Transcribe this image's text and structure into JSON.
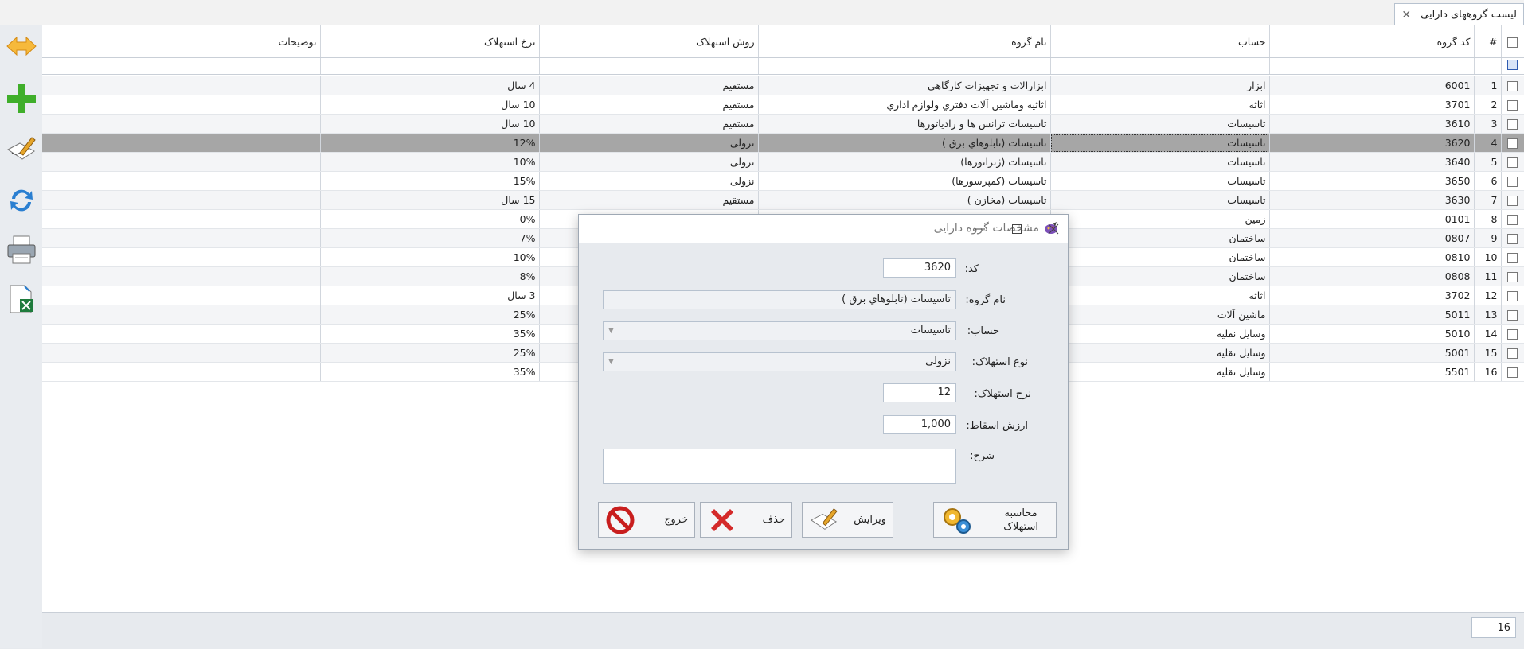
{
  "tab": {
    "title": "لیست گروههای دارایی",
    "close_glyph": "✕"
  },
  "toolbar": {
    "icons": [
      "expand-arrows-icon",
      "add-icon",
      "edit-icon",
      "refresh-icon",
      "print-icon",
      "excel-export-icon"
    ]
  },
  "grid": {
    "headers": {
      "row_number": "#",
      "code": "کد گروه",
      "account": "حساب",
      "group_name": "نام گروه",
      "method": "روش استهلاک",
      "rate": "نرخ استهلاک",
      "description": "توضیحات"
    },
    "rows": [
      {
        "n": "1",
        "code": "6001",
        "account": "ابزار",
        "name": "ابزارالات و تجهیزات کارگاهی",
        "method": "مستقیم",
        "rate": "4 سال",
        "desc": ""
      },
      {
        "n": "2",
        "code": "3701",
        "account": "اثاثه",
        "name": "اثاثیه وماشین آلات دفتري ولوازم اداري",
        "method": "مستقیم",
        "rate": "10 سال",
        "desc": ""
      },
      {
        "n": "3",
        "code": "3610",
        "account": "تاسیسات",
        "name": "تاسیسات ترانس ها و رادیاتورها",
        "method": "مستقیم",
        "rate": "10 سال",
        "desc": ""
      },
      {
        "n": "4",
        "code": "3620",
        "account": "تاسیسات",
        "name": "تاسیسات (تابلوهاي برق )",
        "method": "نزولی",
        "rate": "12%",
        "desc": ""
      },
      {
        "n": "5",
        "code": "3640",
        "account": "تاسیسات",
        "name": "تاسیسات (ژنراتورها)",
        "method": "نزولی",
        "rate": "10%",
        "desc": ""
      },
      {
        "n": "6",
        "code": "3650",
        "account": "تاسیسات",
        "name": "تاسیسات (کمپرسورها)",
        "method": "نزولی",
        "rate": "15%",
        "desc": ""
      },
      {
        "n": "7",
        "code": "3630",
        "account": "تاسیسات",
        "name": "تاسیسات (مخازن )",
        "method": "مستقیم",
        "rate": "15 سال",
        "desc": ""
      },
      {
        "n": "8",
        "code": "0101",
        "account": "زمین",
        "name": "",
        "method": "",
        "rate": "0%",
        "desc": ""
      },
      {
        "n": "9",
        "code": "0807",
        "account": "ساختمان",
        "name": "",
        "method": "",
        "rate": "7%",
        "desc": ""
      },
      {
        "n": "10",
        "code": "0810",
        "account": "ساختمان",
        "name": "",
        "method": "",
        "rate": "10%",
        "desc": ""
      },
      {
        "n": "11",
        "code": "0808",
        "account": "ساختمان",
        "name": "",
        "method": "",
        "rate": "8%",
        "desc": ""
      },
      {
        "n": "12",
        "code": "3702",
        "account": "اثاثه",
        "name": "",
        "method": "",
        "rate": "3 سال",
        "desc": ""
      },
      {
        "n": "13",
        "code": "5011",
        "account": "ماشین آلات",
        "name": "",
        "method": "",
        "rate": "25%",
        "desc": ""
      },
      {
        "n": "14",
        "code": "5010",
        "account": "وسایل نقلیه",
        "name": "",
        "method": "",
        "rate": "35%",
        "desc": ""
      },
      {
        "n": "15",
        "code": "5001",
        "account": "وسایل نقلیه",
        "name": "",
        "method": "",
        "rate": "25%",
        "desc": ""
      },
      {
        "n": "16",
        "code": "5501",
        "account": "وسایل نقلیه",
        "name": "",
        "method": "",
        "rate": "35%",
        "desc": ""
      }
    ],
    "selected_row": 4
  },
  "footer": {
    "record_count": "16"
  },
  "dialog": {
    "title": "مشخصات گروه دارایی",
    "labels": {
      "code": "کد:",
      "group_name": "نام گروه:",
      "account": "حساب:",
      "depreciation_type": "نوع استهلاک:",
      "rate": "نرخ استهلاک:",
      "salvage": "ارزش اسقاط:",
      "description": "شرح:"
    },
    "values": {
      "code": "3620",
      "group_name": "تاسیسات (تابلوهاي برق )",
      "account": "تاسیسات",
      "depreciation_type": "نزولی",
      "rate": "12",
      "salvage": "1,000",
      "description": ""
    },
    "buttons": {
      "exit": "خروج",
      "delete": "حذف",
      "edit": "ویرایش",
      "calc_line1": "محاسبه",
      "calc_line2": "استهلاک"
    }
  }
}
